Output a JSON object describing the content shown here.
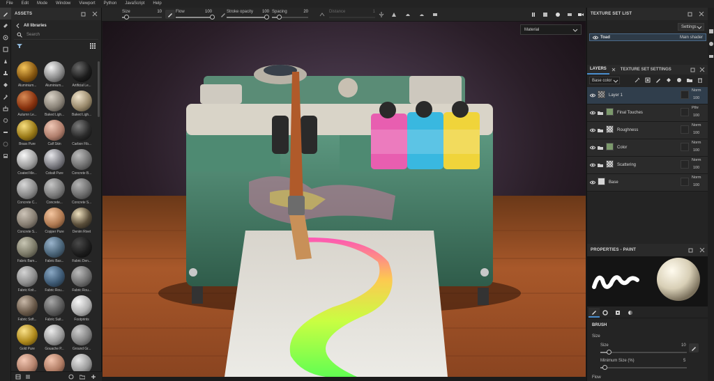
{
  "menu": [
    "File",
    "Edit",
    "Mode",
    "Window",
    "Viewport",
    "Python",
    "JavaScript",
    "Help"
  ],
  "toolbar": {
    "size_label": "Size",
    "size_value": "10",
    "size_level": 0.1,
    "flow_label": "Flow",
    "flow_value": "100",
    "flow_level": 1.0,
    "opacity_label": "Stroke opacity",
    "opacity_value": "100",
    "opacity_level": 1.0,
    "spacing_label": "Spacing",
    "spacing_value": "20",
    "spacing_level": 0.2,
    "distance_label": "Distance",
    "distance_value": "1"
  },
  "assets": {
    "title": "ASSETS",
    "library": "All libraries",
    "search_placeholder": "Search",
    "materials": [
      {
        "name": "Aluminium...",
        "c1": "#f4c45a",
        "c2": "#8a5a12",
        "c3": "#2a1803"
      },
      {
        "name": "Aluminium...",
        "c1": "#f2f2f2",
        "c2": "#8a8a8a",
        "c3": "#262626"
      },
      {
        "name": "Artificial Le...",
        "c1": "#6a6a6a",
        "c2": "#1c1c1c",
        "c3": "#050505"
      },
      {
        "name": "Autumn Le...",
        "c1": "#d88a55",
        "c2": "#8a3410",
        "c3": "#2a0c02"
      },
      {
        "name": "Baked Ligh...",
        "c1": "#d9d2c6",
        "c2": "#8a8378",
        "c3": "#2b2824"
      },
      {
        "name": "Baked Ligh...",
        "c1": "#f0e4cc",
        "c2": "#9a8a6c",
        "c3": "#302a1c"
      },
      {
        "name": "Brass Pure",
        "c1": "#f7de7e",
        "c2": "#9a7a18",
        "c3": "#2e2206"
      },
      {
        "name": "Calf Skin",
        "c1": "#f0c8b6",
        "c2": "#b07e6c",
        "c3": "#3a2720"
      },
      {
        "name": "Carbon Fib...",
        "c1": "#7c7c7c",
        "c2": "#2a2a2a",
        "c3": "#080808"
      },
      {
        "name": "Coated Me...",
        "c1": "#f8f8f8",
        "c2": "#a0a0a0",
        "c3": "#3a3a3a"
      },
      {
        "name": "Cobalt Pure",
        "c1": "#e6e6ea",
        "c2": "#7c7c82",
        "c3": "#222226"
      },
      {
        "name": "Concrete B...",
        "c1": "#bdbdbd",
        "c2": "#707070",
        "c3": "#2a2a2a"
      },
      {
        "name": "Concrete C...",
        "c1": "#d8d8d8",
        "c2": "#8a8a8a",
        "c3": "#323232"
      },
      {
        "name": "Concrete...",
        "c1": "#c6c6c6",
        "c2": "#7a7a7a",
        "c3": "#2c2c2c"
      },
      {
        "name": "Concrete S...",
        "c1": "#b5b5b5",
        "c2": "#6c6c6c",
        "c3": "#262626"
      },
      {
        "name": "Concrete S...",
        "c1": "#cdc4b8",
        "c2": "#877e72",
        "c3": "#2e2a26"
      },
      {
        "name": "Copper Pure",
        "c1": "#f4c6a0",
        "c2": "#b07a52",
        "c3": "#3a2414"
      },
      {
        "name": "Denim Rivet",
        "c1": "#f0e2c0",
        "c2": "#5a4e3a",
        "c3": "#141210"
      },
      {
        "name": "Fabric Bam...",
        "c1": "#c8c6b4",
        "c2": "#7c7a68",
        "c3": "#2a2922"
      },
      {
        "name": "Fabric Bas...",
        "c1": "#9ab4cc",
        "c2": "#4a6478",
        "c3": "#18222c"
      },
      {
        "name": "Fabric Den...",
        "c1": "#4a4a4a",
        "c2": "#1c1c1c",
        "c3": "#060606"
      },
      {
        "name": "Fabric Knit...",
        "c1": "#d4d4d4",
        "c2": "#8c8c8c",
        "c3": "#2e2e2e"
      },
      {
        "name": "Fabric Rou...",
        "c1": "#8aa8c4",
        "c2": "#3e5a74",
        "c3": "#141e28"
      },
      {
        "name": "Fabric Rou...",
        "c1": "#bcbcbc",
        "c2": "#6e6e6e",
        "c3": "#242424"
      },
      {
        "name": "Fabric Soft...",
        "c1": "#c8b8a8",
        "c2": "#6a5a4a",
        "c3": "#221c16"
      },
      {
        "name": "Fabric Suit...",
        "c1": "#a8a8a8",
        "c2": "#5a5a5a",
        "c3": "#1c1c1c"
      },
      {
        "name": "Footprints",
        "c1": "#f8f8f8",
        "c2": "#b0b0b0",
        "c3": "#404040"
      },
      {
        "name": "Gold Pure",
        "c1": "#fae28a",
        "c2": "#b08a1c",
        "c3": "#3a2c06"
      },
      {
        "name": "Gouache P...",
        "c1": "#ececec",
        "c2": "#9a9a9a",
        "c3": "#333333"
      },
      {
        "name": "Ground Gr...",
        "c1": "#cfcfcf",
        "c2": "#828282",
        "c3": "#2c2c2c"
      },
      {
        "name": "",
        "c1": "#f4c8b4",
        "c2": "#b4826c",
        "c3": "#3a2620"
      },
      {
        "name": "",
        "c1": "#f2c4ae",
        "c2": "#b07c64",
        "c3": "#38241c"
      },
      {
        "name": "",
        "c1": "#e8e8e8",
        "c2": "#9a9a9a",
        "c3": "#303030"
      }
    ]
  },
  "viewport": {
    "material_selector": "Material"
  },
  "texture_set_list": {
    "title": "TEXTURE SET LIST",
    "settings_label": "Settings",
    "set_name": "Toad",
    "shader": "Main shader"
  },
  "layers_panel": {
    "tab_layers": "LAYERS",
    "tab_settings": "TEXTURE SET SETTINGS",
    "channel": "Base color",
    "layers": [
      {
        "name": "Layer 1",
        "blend": "Norm",
        "opacity": "100",
        "type": "paint",
        "selected": true
      },
      {
        "name": "Final Touches",
        "blend": "Pthr",
        "opacity": "100",
        "type": "folder-green"
      },
      {
        "name": "Roughness",
        "blend": "Norm",
        "opacity": "100",
        "type": "folder-checker"
      },
      {
        "name": "Color",
        "blend": "Norm",
        "opacity": "100",
        "type": "folder-green"
      },
      {
        "name": "Scattering",
        "blend": "Norm",
        "opacity": "100",
        "type": "folder-checker"
      },
      {
        "name": "Base",
        "blend": "Norm",
        "opacity": "100",
        "type": "fill"
      }
    ]
  },
  "properties": {
    "title": "PROPERTIES - PAINT",
    "section": "BRUSH",
    "size_group": "Size",
    "size_label": "Size",
    "size_value": "10",
    "size_level": 0.1,
    "min_size_label": "Minimum Size (%)",
    "min_size_value": "5",
    "min_size_level": 0.05,
    "flow_group": "Flow"
  },
  "colors": {
    "accent": "#4a8fd0",
    "panel": "#252525",
    "selected_layer": "#303e4c"
  }
}
